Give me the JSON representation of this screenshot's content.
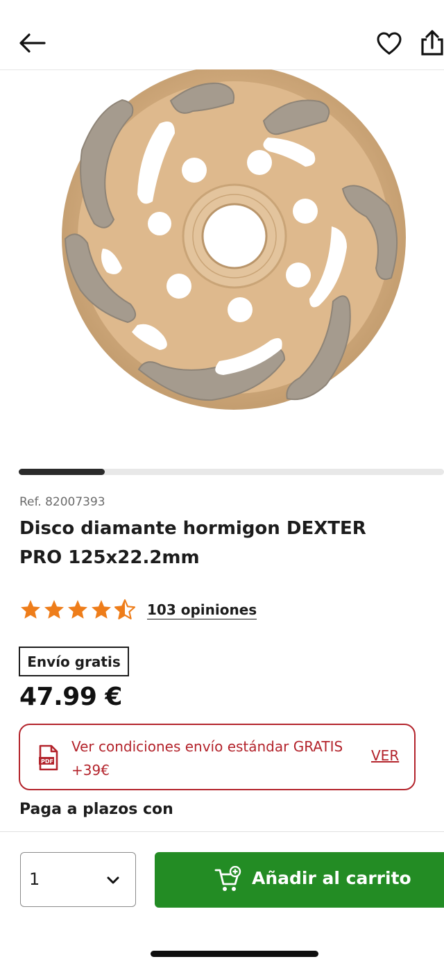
{
  "header": {
    "back_icon": "arrow-left-icon",
    "favorite_icon": "heart-icon",
    "share_icon": "share-icon"
  },
  "gallery": {
    "image_alt": "diamond-cup-grinding-disc-image",
    "current_index": 1,
    "total_images_fraction_visible": 0.2
  },
  "product": {
    "ref": "Ref. 82007393",
    "title": "Disco diamante hormigon DEXTER PRO 125x22.2mm",
    "rating": 4.5,
    "reviews": "103 opiniones",
    "badge": "Envío gratis",
    "price": "47.99 €"
  },
  "shipping": {
    "icon": "pdf-icon",
    "text": "Ver condiciones envío estándar GRATIS +39€",
    "link": "VER",
    "color": "#b3232b"
  },
  "installments": {
    "label": "Paga a plazos con"
  },
  "purchase": {
    "quantity": "1",
    "add_to_cart": "Añadir al carrito",
    "button_color": "#238c24"
  },
  "colors": {
    "star": "#ee7d1a",
    "text": "#1c1c1c"
  }
}
